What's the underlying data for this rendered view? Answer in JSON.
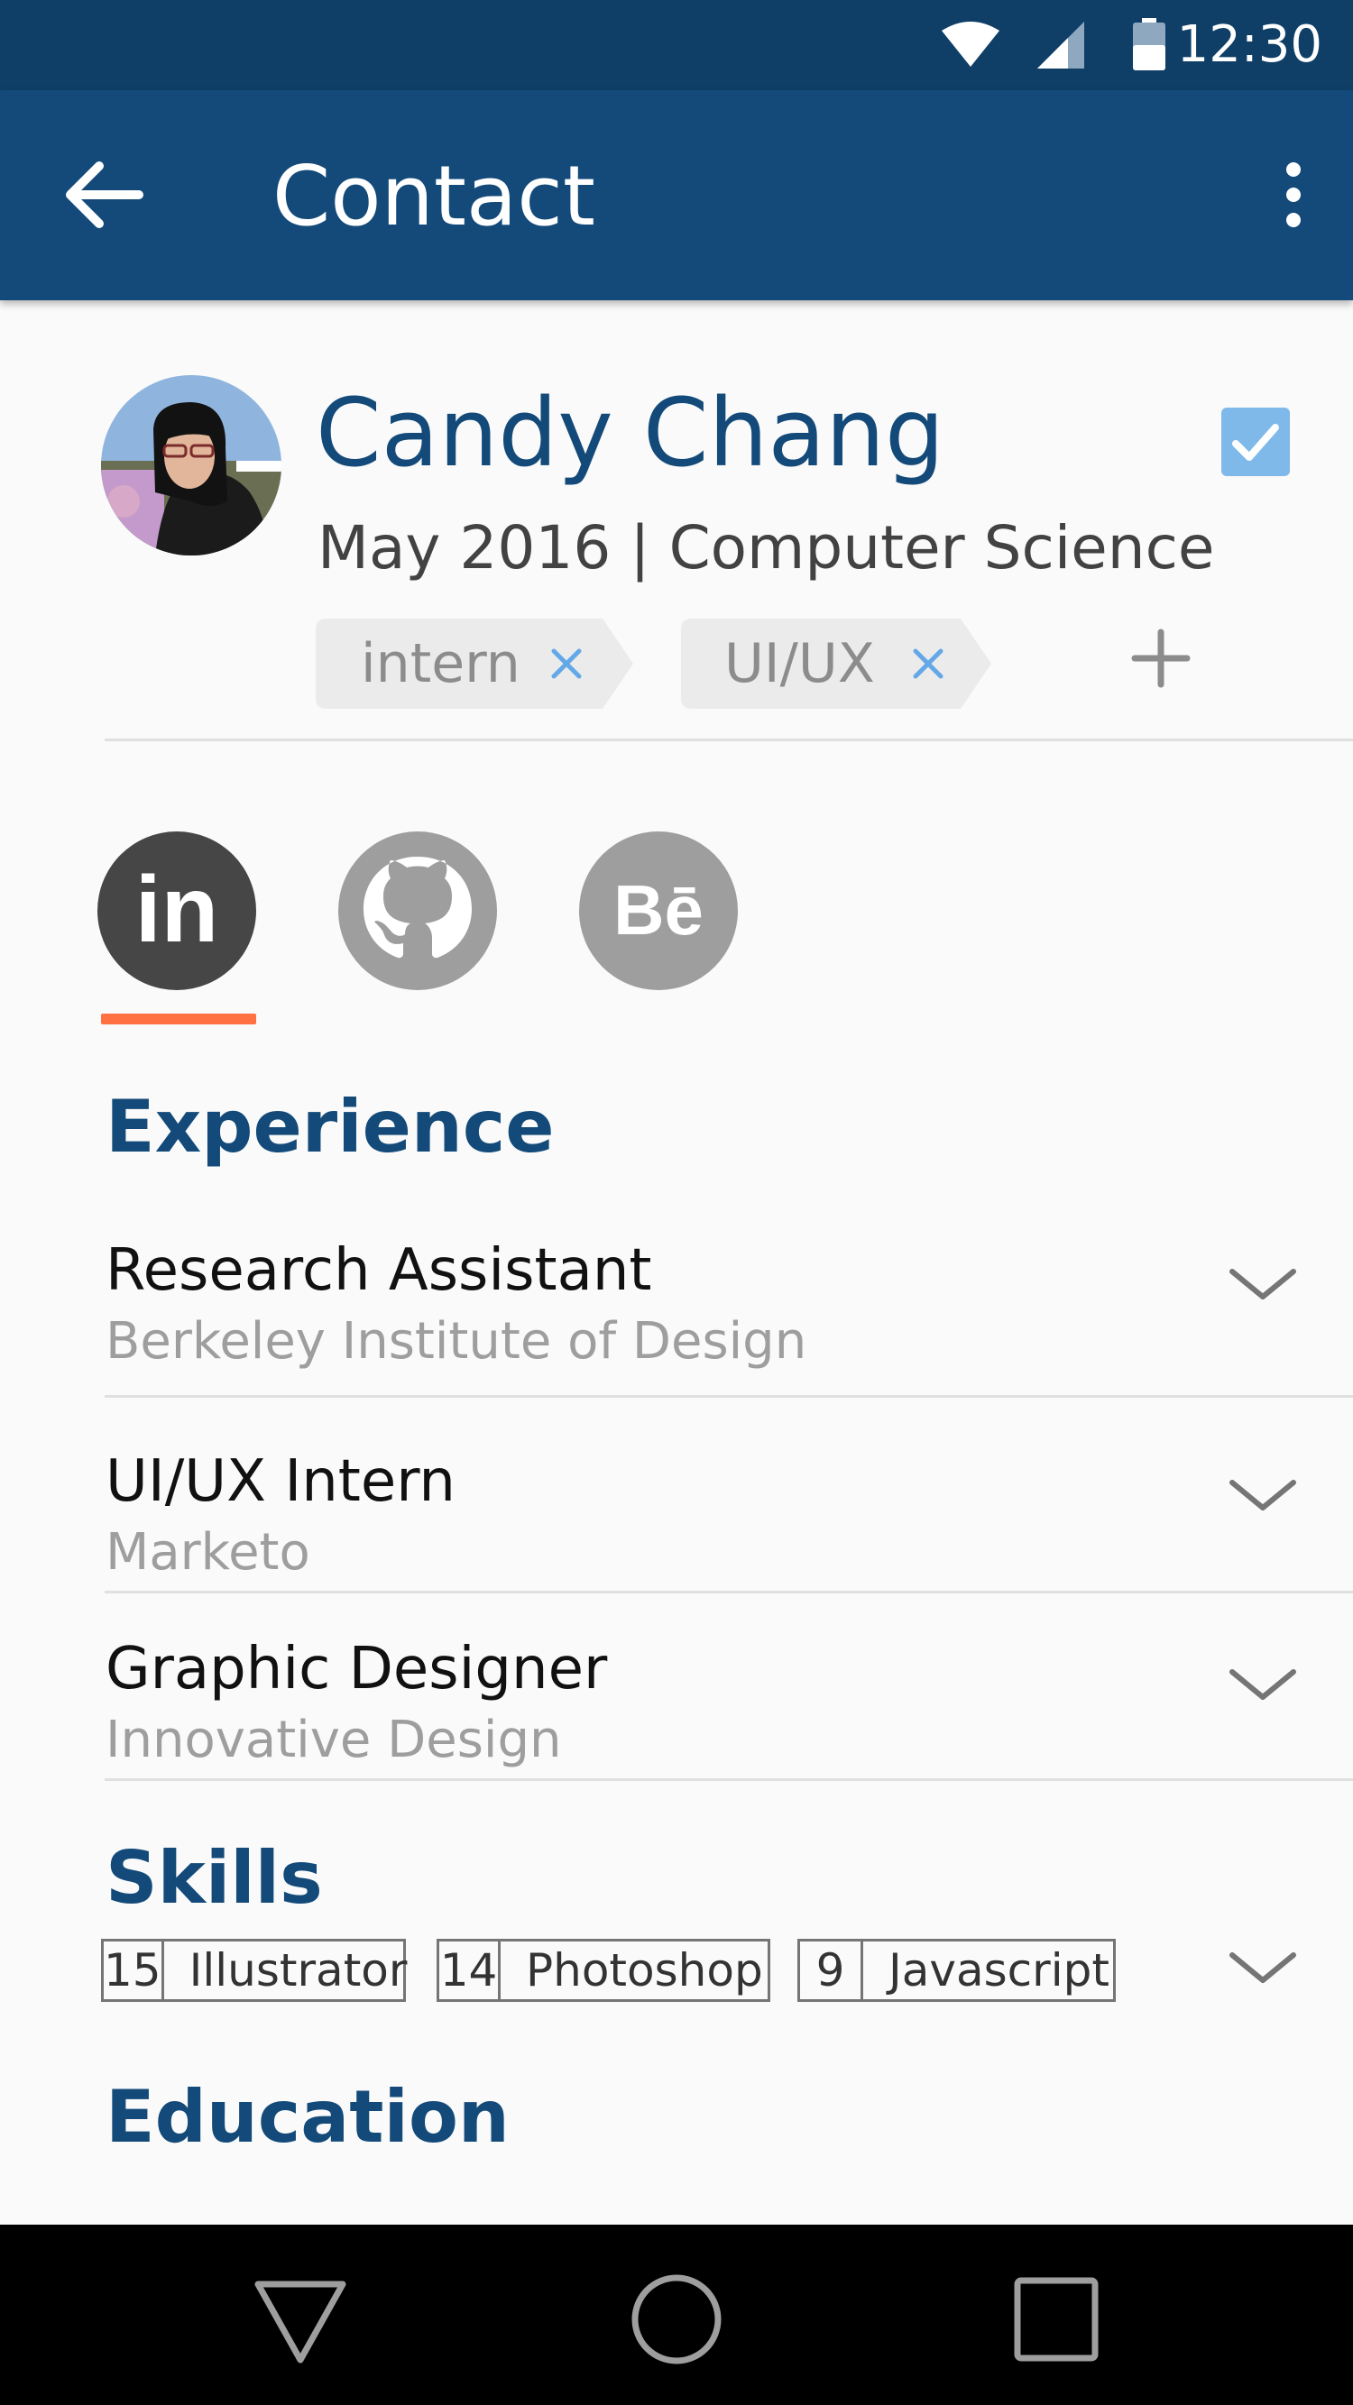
{
  "status_bar": {
    "time": "12:30",
    "icons": [
      "wifi-icon",
      "cell-signal-icon",
      "battery-icon"
    ]
  },
  "app_bar": {
    "title": "Contact",
    "back_icon": "arrow-left-icon",
    "menu_icon": "more-vert-icon"
  },
  "profile": {
    "name": "Candy Chang",
    "subtitle": "May 2016 | Computer Science",
    "selected": true,
    "tags": [
      {
        "label": "intern"
      },
      {
        "label": "UI/UX"
      }
    ],
    "add_tag_icon": "plus-icon"
  },
  "social": {
    "items": [
      {
        "name": "LinkedIn",
        "label": "in",
        "active": true
      },
      {
        "name": "GitHub",
        "active": false
      },
      {
        "name": "Behance",
        "label": "Bē",
        "active": false
      }
    ]
  },
  "experience": {
    "title": "Experience",
    "items": [
      {
        "title": "Research Assistant",
        "org": "Berkeley Institute of Design"
      },
      {
        "title": "UI/UX Intern",
        "org": "Marketo"
      },
      {
        "title": "Graphic Designer",
        "org": "Innovative Design"
      }
    ]
  },
  "skills": {
    "title": "Skills",
    "items": [
      {
        "count": "15",
        "name": "Illustrator"
      },
      {
        "count": "14",
        "name": "Photoshop"
      },
      {
        "count": "9",
        "name": "Javascript"
      }
    ]
  },
  "education": {
    "title": "Education"
  },
  "colors": {
    "status_bar": "#0f3f67",
    "app_bar": "#134a79",
    "accent_underline": "#ff7043",
    "checkbox": "#7fb9ea",
    "tag_x": "#64a8e8"
  },
  "nav": {
    "icons": [
      "back-triangle-icon",
      "home-circle-icon",
      "recents-square-icon"
    ]
  }
}
